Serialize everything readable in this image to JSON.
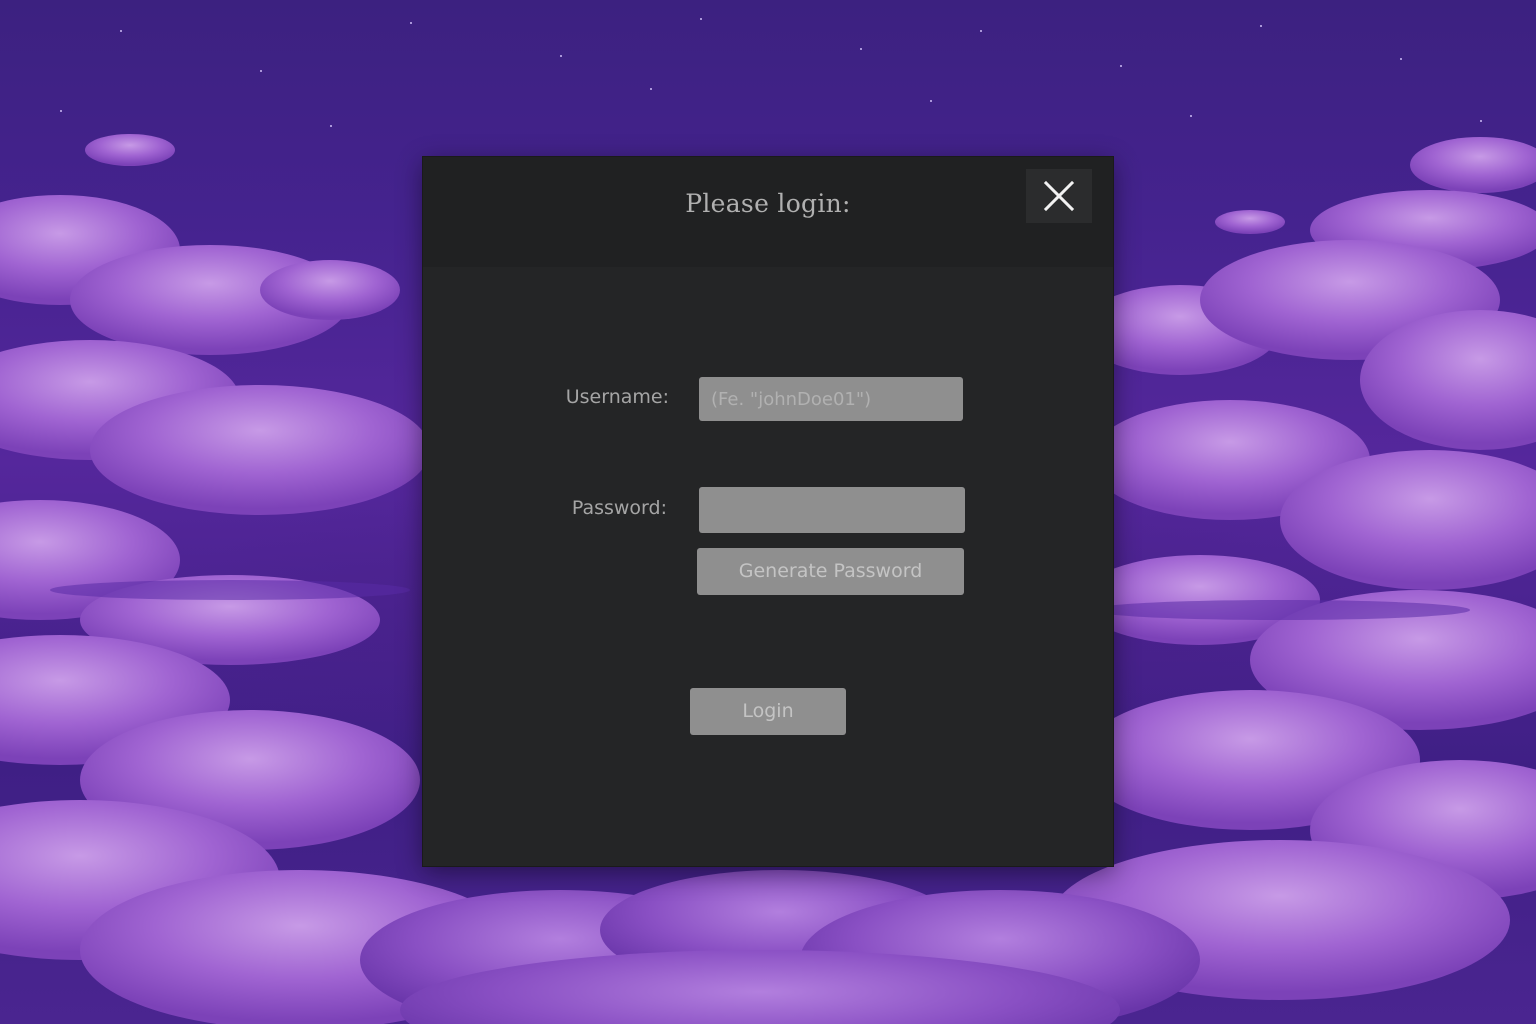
{
  "dialog": {
    "title": "Please login:",
    "close_icon": "close-icon",
    "username": {
      "label": "Username:",
      "placeholder": "(Fe. \"johnDoe01\")",
      "value": ""
    },
    "password": {
      "label": "Password:",
      "placeholder": "",
      "value": ""
    },
    "generate_label": "Generate Password",
    "login_label": "Login"
  },
  "colors": {
    "sky_top": "#3c2180",
    "sky_mid": "#55279c",
    "cloud": "#a56ad6",
    "cloud_highlight": "#c89ae8",
    "dialog_bg": "#242526",
    "header_bg": "#202122",
    "control_bg": "#8f8f8f",
    "text_muted": "#a5a5a5"
  }
}
